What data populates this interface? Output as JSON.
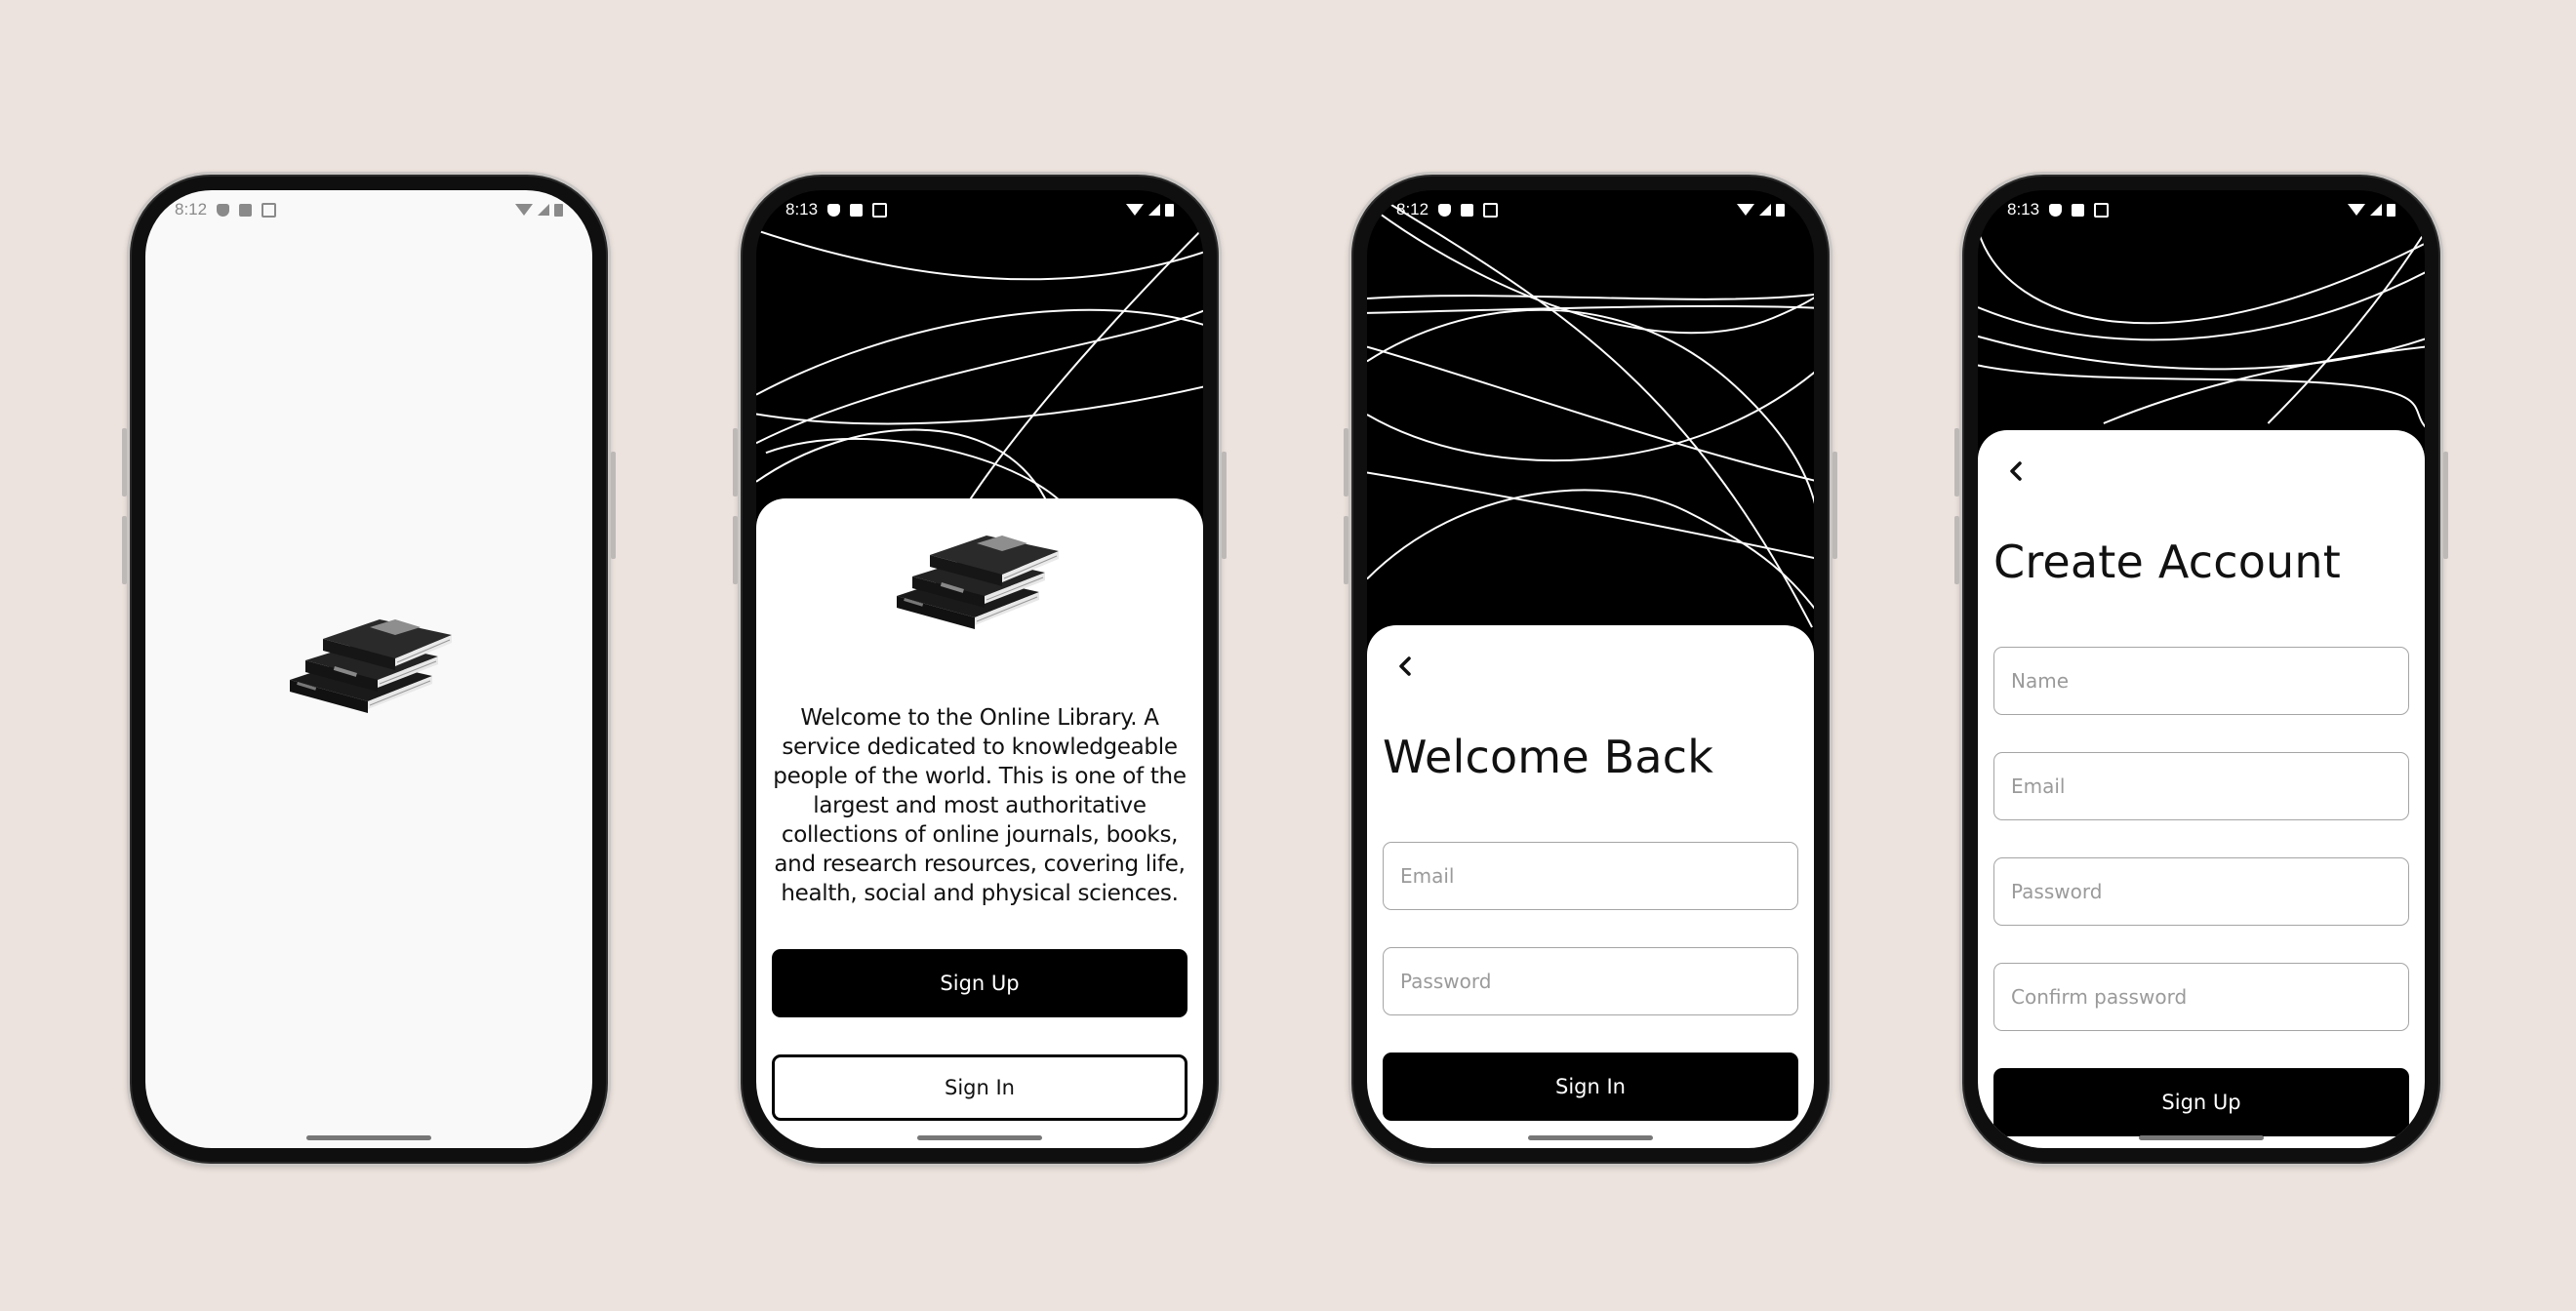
{
  "theme": {
    "background": "#ede3de",
    "accent": "#000000",
    "surface": "#ffffff"
  },
  "screens": [
    {
      "name": "splash",
      "status": {
        "time": "8:12"
      },
      "logo_icon": "books-stack-icon"
    },
    {
      "name": "onboarding",
      "status": {
        "time": "8:13"
      },
      "logo_icon": "books-stack-icon",
      "description": "Welcome to the Online Library. A service dedicated to knowledgeable people of the world. This is one of the largest and most authoritative collections of online journals, books, and research resources, covering  life, health, social and physical sciences.",
      "signup_label": "Sign Up",
      "signin_label": "Sign In"
    },
    {
      "name": "sign-in",
      "status": {
        "time": "8:12"
      },
      "title": "Welcome Back",
      "email_placeholder": "Email",
      "password_placeholder": "Password",
      "signin_label": "Sign In"
    },
    {
      "name": "create-account",
      "status": {
        "time": "8:13"
      },
      "title": "Create Account",
      "name_placeholder": "Name",
      "email_placeholder": "Email",
      "password_placeholder": "Password",
      "confirm_placeholder": "Confirm password",
      "signup_label": "Sign Up"
    }
  ]
}
